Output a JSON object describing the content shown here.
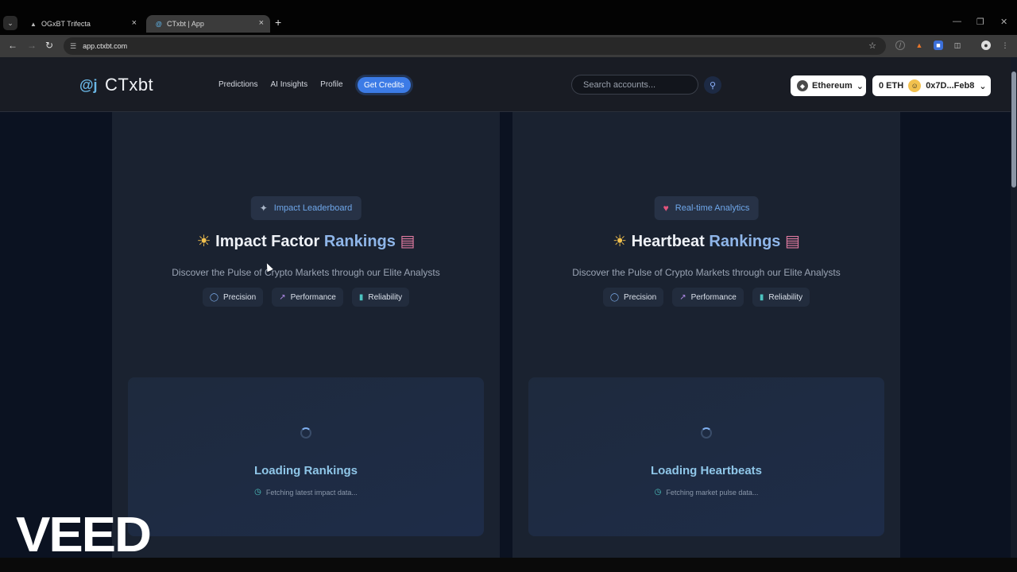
{
  "browser": {
    "tabs": [
      {
        "title": "OGxBT Trifecta",
        "favicon": "triangle-icon"
      },
      {
        "title": "CTxbt | App",
        "favicon": "ctxbt-logo-icon",
        "active": true
      }
    ],
    "url": "app.ctxbt.com"
  },
  "header": {
    "logo_text": "CTxbt",
    "nav": [
      "Predictions",
      "AI Insights",
      "Profile"
    ],
    "cta": "Get Credits",
    "search_placeholder": "Search accounts...",
    "chain": "Ethereum",
    "balance": "0 ETH",
    "address": "0x7D...Feb8"
  },
  "cards": [
    {
      "badge": "Impact Leaderboard",
      "badge_icon": "magic-wand-icon",
      "title_main": "Impact Factor",
      "title_accent": "Rankings",
      "subtitle": "Discover the Pulse of Crypto Markets through our Elite Analysts",
      "chips": [
        "Precision",
        "Performance",
        "Reliability"
      ],
      "loading_title": "Loading Rankings",
      "loading_sub": "Fetching latest impact data..."
    },
    {
      "badge": "Real-time Analytics",
      "badge_icon": "heart-icon",
      "title_main": "Heartbeat",
      "title_accent": "Rankings",
      "subtitle": "Discover the Pulse of Crypto Markets through our Elite Analysts",
      "chips": [
        "Precision",
        "Performance",
        "Reliability"
      ],
      "loading_title": "Loading Heartbeats",
      "loading_sub": "Fetching market pulse data..."
    }
  ],
  "watermark": "VEED",
  "colors": {
    "accent": "#3c7be6",
    "page_bg": "#0b1221",
    "card_bg": "#1a2230",
    "title_accent": "#8fb6e9"
  }
}
